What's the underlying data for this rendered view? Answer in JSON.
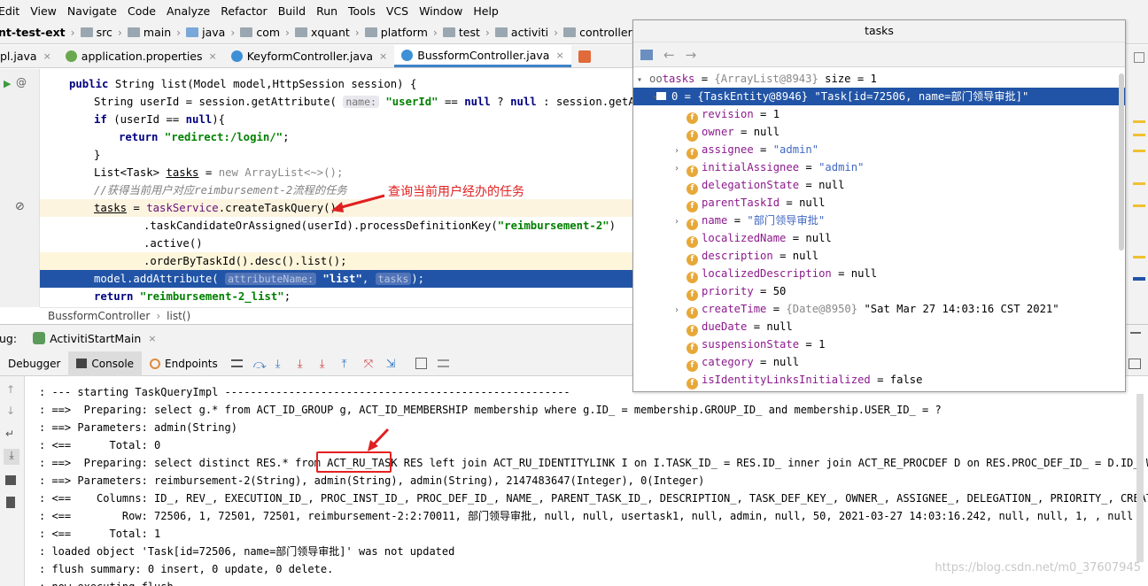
{
  "menu": [
    "Edit",
    "View",
    "Navigate",
    "Code",
    "Analyze",
    "Refactor",
    "Build",
    "Run",
    "Tools",
    "VCS",
    "Window",
    "Help"
  ],
  "breadcrumb": [
    "nt-test-ext",
    "src",
    "main",
    "java",
    "com",
    "xquant",
    "platform",
    "test",
    "activiti",
    "controller"
  ],
  "tabs": [
    {
      "label": "pl.java",
      "active": false
    },
    {
      "label": "application.properties",
      "active": false
    },
    {
      "label": "KeyformController.java",
      "active": false
    },
    {
      "label": "BussformController.java",
      "active": true
    }
  ],
  "code": {
    "l1_a": "public",
    "l1_b": " String list(Model model,HttpSession session) {",
    "l2_a": "String userId = session.getAttribute( ",
    "l2_hint": "name:",
    "l2_str": "\"userId\"",
    "l2_b": " == ",
    "l2_null1": "null",
    "l2_c": " ? ",
    "l2_null2": "null",
    "l2_d": " : session.getAttri",
    "l3_a": "if",
    "l3_b": " (userId == ",
    "l3_null": "null",
    "l3_c": "){",
    "l4_a": "return",
    "l4_str": "\"redirect:/login/\"",
    "l4_b": ";",
    "l5": "}",
    "l6_a": "List<Task> ",
    "l6_var": "tasks",
    "l6_b": " = ",
    "l6_new": "new",
    "l6_c": " ArrayList<~>();",
    "l7_comment": "//获得当前用户对应reimbursement-2流程的任务",
    "l8_var": "tasks",
    "l8_b": " = ",
    "l8_field": "taskService",
    "l8_c": ".createTaskQuery()",
    "l9_a": ".taskCandidateOrAssigned(userId).processDefinitionKey(",
    "l9_str": "\"reimbursement-2\"",
    "l9_b": ")",
    "l10": ".active()",
    "l11": ".orderByTaskId().desc().list();",
    "l12_a": "model.addAttribute( ",
    "l12_hint": "attributeName:",
    "l12_str": "\"list\"",
    "l12_b": ", ",
    "l12_var": "tasks",
    "l12_c": ");",
    "l13_a": "return",
    "l13_str": "\"reimbursement-2_list\"",
    "l13_b": ";"
  },
  "annotation": "查询当前用户经办的任务",
  "editor_breadcrumb": [
    "BussformController",
    "list()"
  ],
  "debug": {
    "label": "ug:",
    "session": "ActivitiStartMain",
    "tabs": [
      "Debugger",
      "Console",
      "Endpoints"
    ]
  },
  "console_lines": [
    ": --- starting TaskQueryImpl ------------------------------------------------------",
    ": ==>  Preparing: select g.* from ACT_ID_GROUP g, ACT_ID_MEMBERSHIP membership where g.ID_ = membership.GROUP_ID_ and membership.USER_ID_ = ?",
    ": ==> Parameters: admin(String)",
    ": <==      Total: 0",
    ": ==>  Preparing: select distinct RES.* from ACT_RU_TASK RES left join ACT_RU_IDENTITYLINK I on I.TASK_ID_ = RES.ID_ inner join ACT_RE_PROCDEF D on RES.PROC_DEF_ID_ = D.ID_ WHERE",
    ": ==> Parameters: reimbursement-2(String), admin(String), admin(String), 2147483647(Integer), 0(Integer)",
    ": <==    Columns: ID_, REV_, EXECUTION_ID_, PROC_INST_ID_, PROC_DEF_ID_, NAME_, PARENT_TASK_ID_, DESCRIPTION_, TASK_DEF_KEY_, OWNER_, ASSIGNEE_, DELEGATION_, PRIORITY_, CREATE_TIM",
    ": <==        Row: 72506, 1, 72501, 72501, reimbursement-2:2:70011, 部门领导审批, null, null, usertask1, null, admin, null, 50, 2021-03-27 14:03:16.242, null, null, 1, , null",
    ": <==      Total: 1",
    ": loaded object 'Task[id=72506, name=部门领导审批]' was not updated",
    ": flush summary: 0 insert, 0 update, 0 delete.",
    ": now executing flush"
  ],
  "watermark": "https://blog.csdn.net/m0_37607945",
  "popup": {
    "title": "tasks",
    "root": {
      "name": "tasks",
      "ref": "{ArrayList@8943}",
      "extra": "size = 1"
    },
    "selected": {
      "label": "0 = {TaskEntity@8946} \"Task[id=72506, name=部门领导审批]\""
    },
    "fields": [
      {
        "name": "revision",
        "value": "= 1",
        "expandable": false
      },
      {
        "name": "owner",
        "value": "= null",
        "expandable": false
      },
      {
        "name": "assignee",
        "value": "\"admin\"",
        "expandable": true,
        "str": true
      },
      {
        "name": "initialAssignee",
        "value": "\"admin\"",
        "expandable": true,
        "str": true
      },
      {
        "name": "delegationState",
        "value": "= null",
        "expandable": false
      },
      {
        "name": "parentTaskId",
        "value": "= null",
        "expandable": false
      },
      {
        "name": "name",
        "value": "\"部门领导审批\"",
        "expandable": true,
        "str": true
      },
      {
        "name": "localizedName",
        "value": "= null",
        "expandable": false
      },
      {
        "name": "description",
        "value": "= null",
        "expandable": false
      },
      {
        "name": "localizedDescription",
        "value": "= null",
        "expandable": false
      },
      {
        "name": "priority",
        "value": "= 50",
        "expandable": false
      },
      {
        "name": "createTime",
        "value": "\"Sat Mar 27 14:03:16 CST 2021\"",
        "ref": "{Date@8950}",
        "expandable": true
      },
      {
        "name": "dueDate",
        "value": "= null",
        "expandable": false
      },
      {
        "name": "suspensionState",
        "value": "= 1",
        "expandable": false
      },
      {
        "name": "category",
        "value": "= null",
        "expandable": false
      },
      {
        "name": "isIdentityLinksInitialized",
        "value": "= false",
        "expandable": false
      }
    ]
  }
}
